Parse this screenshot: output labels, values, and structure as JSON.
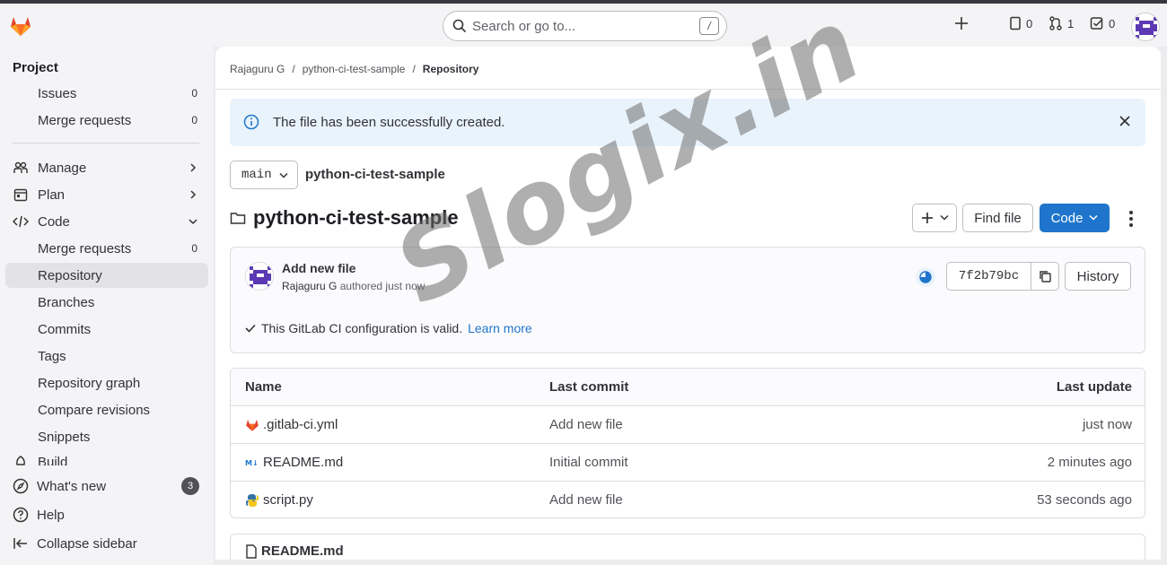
{
  "topbar": {
    "search_placeholder": "Search or go to...",
    "search_shortcut": "/",
    "issues_count": "0",
    "merge_requests_count": "1",
    "todos_count": "0"
  },
  "sidebar": {
    "section_title": "Project",
    "top_items": [
      {
        "label": "Issues",
        "count": "0"
      },
      {
        "label": "Merge requests",
        "count": "0"
      }
    ],
    "groups": [
      {
        "label": "Manage"
      },
      {
        "label": "Plan"
      },
      {
        "label": "Code"
      }
    ],
    "code_items": [
      {
        "label": "Merge requests",
        "count": "0"
      },
      {
        "label": "Repository"
      },
      {
        "label": "Branches"
      },
      {
        "label": "Commits"
      },
      {
        "label": "Tags"
      },
      {
        "label": "Repository graph"
      },
      {
        "label": "Compare revisions"
      },
      {
        "label": "Snippets"
      }
    ],
    "build_label": "Build",
    "bottom": {
      "whats_new": "What's new",
      "whats_new_badge": "3",
      "help": "Help",
      "collapse": "Collapse sidebar"
    }
  },
  "breadcrumb": [
    "Rajaguru G",
    "python-ci-test-sample",
    "Repository"
  ],
  "alert": {
    "message": "The file has been successfully created."
  },
  "repo": {
    "branch": "main",
    "crumb": "python-ci-test-sample",
    "title": "python-ci-test-sample",
    "find_file": "Find file",
    "code": "Code"
  },
  "last_commit": {
    "title": "Add new file",
    "author": "Rajaguru G",
    "meta": "authored just now",
    "sha": "7f2b79bc",
    "history": "History",
    "ci_message": "This GitLab CI configuration is valid.",
    "ci_link": "Learn more"
  },
  "files": {
    "headers": [
      "Name",
      "Last commit",
      "Last update"
    ],
    "rows": [
      {
        "name": ".gitlab-ci.yml",
        "commit": "Add new file",
        "updated": "just now"
      },
      {
        "name": "README.md",
        "commit": "Initial commit",
        "updated": "2 minutes ago"
      },
      {
        "name": "script.py",
        "commit": "Add new file",
        "updated": "53 seconds ago"
      }
    ]
  },
  "readme_title": "README.md",
  "watermark": "Slogix.in",
  "colors": {
    "primary": "#1f75cb",
    "alert_bg": "#e9f3fc",
    "gitlab_orange": "#e24329"
  }
}
